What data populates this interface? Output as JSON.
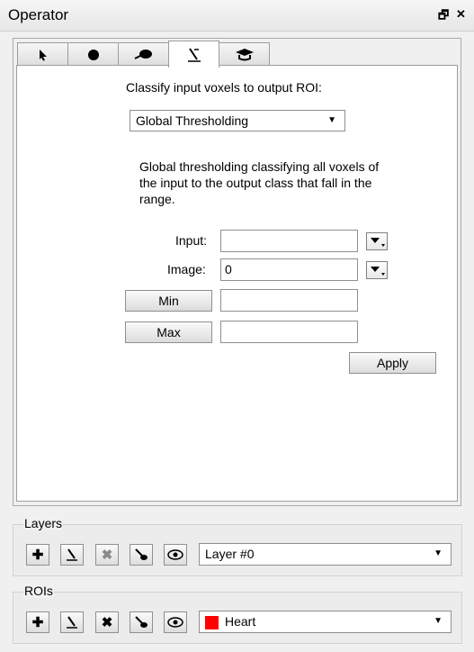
{
  "window": {
    "title": "Operator",
    "float_glyph": "🗗",
    "close_glyph": "✕"
  },
  "tabs": [
    {
      "icon": "pointer-icon"
    },
    {
      "icon": "sphere-icon"
    },
    {
      "icon": "region-grow-icon"
    },
    {
      "icon": "threshold-icon",
      "active": true
    },
    {
      "icon": "hat-icon"
    }
  ],
  "operator": {
    "heading": "Classify input voxels to output ROI:",
    "method": "Global Thresholding",
    "description_lines": [
      "Global thresholding classifying all voxels of",
      "the input to the output class that fall in the",
      "range."
    ],
    "input_label": "Input:",
    "input_value": "",
    "image_label": "Image:",
    "image_value": "0",
    "min_label": "Min",
    "min_value": "",
    "max_label": "Max",
    "max_value": "",
    "apply_label": "Apply"
  },
  "layers": {
    "title": "Layers",
    "selected": "Layer #0"
  },
  "rois": {
    "title": "ROIs",
    "selected": "Heart",
    "color": "#ff0000"
  },
  "glyphs": {
    "dropdown_arrow": "▼"
  }
}
